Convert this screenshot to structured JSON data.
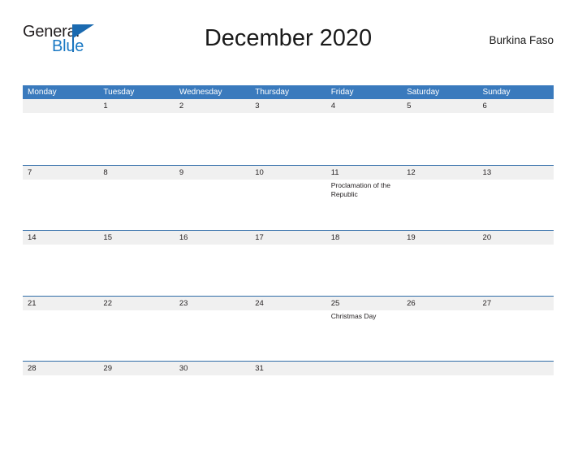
{
  "brand": {
    "name_part1": "General",
    "name_part2": "Blue",
    "flag_icon": "triangle-flag-icon"
  },
  "header": {
    "title": "December 2020",
    "region": "Burkina Faso"
  },
  "calendar": {
    "weekdays": [
      "Monday",
      "Tuesday",
      "Wednesday",
      "Thursday",
      "Friday",
      "Saturday",
      "Sunday"
    ],
    "colors": {
      "header_blue": "#3a7abd",
      "row_line_blue": "#2f6ca8",
      "day_band_gray": "#f0f0f0",
      "brand_blue": "#1b79c4",
      "text_dark": "#231f20"
    },
    "weeks": [
      {
        "days": [
          {
            "number": "",
            "event": ""
          },
          {
            "number": "1",
            "event": ""
          },
          {
            "number": "2",
            "event": ""
          },
          {
            "number": "3",
            "event": ""
          },
          {
            "number": "4",
            "event": ""
          },
          {
            "number": "5",
            "event": ""
          },
          {
            "number": "6",
            "event": ""
          }
        ]
      },
      {
        "days": [
          {
            "number": "7",
            "event": ""
          },
          {
            "number": "8",
            "event": ""
          },
          {
            "number": "9",
            "event": ""
          },
          {
            "number": "10",
            "event": ""
          },
          {
            "number": "11",
            "event": "Proclamation of the Republic"
          },
          {
            "number": "12",
            "event": ""
          },
          {
            "number": "13",
            "event": ""
          }
        ]
      },
      {
        "days": [
          {
            "number": "14",
            "event": ""
          },
          {
            "number": "15",
            "event": ""
          },
          {
            "number": "16",
            "event": ""
          },
          {
            "number": "17",
            "event": ""
          },
          {
            "number": "18",
            "event": ""
          },
          {
            "number": "19",
            "event": ""
          },
          {
            "number": "20",
            "event": ""
          }
        ]
      },
      {
        "days": [
          {
            "number": "21",
            "event": ""
          },
          {
            "number": "22",
            "event": ""
          },
          {
            "number": "23",
            "event": ""
          },
          {
            "number": "24",
            "event": ""
          },
          {
            "number": "25",
            "event": "Christmas Day"
          },
          {
            "number": "26",
            "event": ""
          },
          {
            "number": "27",
            "event": ""
          }
        ]
      },
      {
        "days": [
          {
            "number": "28",
            "event": ""
          },
          {
            "number": "29",
            "event": ""
          },
          {
            "number": "30",
            "event": ""
          },
          {
            "number": "31",
            "event": ""
          },
          {
            "number": "",
            "event": ""
          },
          {
            "number": "",
            "event": ""
          },
          {
            "number": "",
            "event": ""
          }
        ]
      }
    ]
  }
}
